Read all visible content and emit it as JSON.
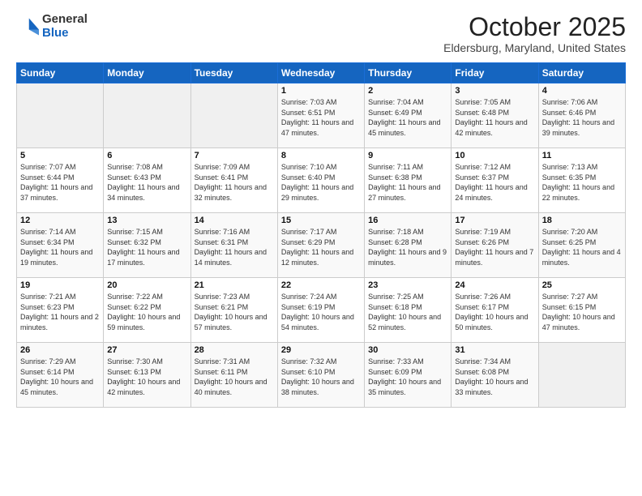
{
  "logo": {
    "general": "General",
    "blue": "Blue"
  },
  "header": {
    "month": "October 2025",
    "location": "Eldersburg, Maryland, United States"
  },
  "weekdays": [
    "Sunday",
    "Monday",
    "Tuesday",
    "Wednesday",
    "Thursday",
    "Friday",
    "Saturday"
  ],
  "weeks": [
    [
      {
        "day": "",
        "info": ""
      },
      {
        "day": "",
        "info": ""
      },
      {
        "day": "",
        "info": ""
      },
      {
        "day": "1",
        "info": "Sunrise: 7:03 AM\nSunset: 6:51 PM\nDaylight: 11 hours and 47 minutes."
      },
      {
        "day": "2",
        "info": "Sunrise: 7:04 AM\nSunset: 6:49 PM\nDaylight: 11 hours and 45 minutes."
      },
      {
        "day": "3",
        "info": "Sunrise: 7:05 AM\nSunset: 6:48 PM\nDaylight: 11 hours and 42 minutes."
      },
      {
        "day": "4",
        "info": "Sunrise: 7:06 AM\nSunset: 6:46 PM\nDaylight: 11 hours and 39 minutes."
      }
    ],
    [
      {
        "day": "5",
        "info": "Sunrise: 7:07 AM\nSunset: 6:44 PM\nDaylight: 11 hours and 37 minutes."
      },
      {
        "day": "6",
        "info": "Sunrise: 7:08 AM\nSunset: 6:43 PM\nDaylight: 11 hours and 34 minutes."
      },
      {
        "day": "7",
        "info": "Sunrise: 7:09 AM\nSunset: 6:41 PM\nDaylight: 11 hours and 32 minutes."
      },
      {
        "day": "8",
        "info": "Sunrise: 7:10 AM\nSunset: 6:40 PM\nDaylight: 11 hours and 29 minutes."
      },
      {
        "day": "9",
        "info": "Sunrise: 7:11 AM\nSunset: 6:38 PM\nDaylight: 11 hours and 27 minutes."
      },
      {
        "day": "10",
        "info": "Sunrise: 7:12 AM\nSunset: 6:37 PM\nDaylight: 11 hours and 24 minutes."
      },
      {
        "day": "11",
        "info": "Sunrise: 7:13 AM\nSunset: 6:35 PM\nDaylight: 11 hours and 22 minutes."
      }
    ],
    [
      {
        "day": "12",
        "info": "Sunrise: 7:14 AM\nSunset: 6:34 PM\nDaylight: 11 hours and 19 minutes."
      },
      {
        "day": "13",
        "info": "Sunrise: 7:15 AM\nSunset: 6:32 PM\nDaylight: 11 hours and 17 minutes."
      },
      {
        "day": "14",
        "info": "Sunrise: 7:16 AM\nSunset: 6:31 PM\nDaylight: 11 hours and 14 minutes."
      },
      {
        "day": "15",
        "info": "Sunrise: 7:17 AM\nSunset: 6:29 PM\nDaylight: 11 hours and 12 minutes."
      },
      {
        "day": "16",
        "info": "Sunrise: 7:18 AM\nSunset: 6:28 PM\nDaylight: 11 hours and 9 minutes."
      },
      {
        "day": "17",
        "info": "Sunrise: 7:19 AM\nSunset: 6:26 PM\nDaylight: 11 hours and 7 minutes."
      },
      {
        "day": "18",
        "info": "Sunrise: 7:20 AM\nSunset: 6:25 PM\nDaylight: 11 hours and 4 minutes."
      }
    ],
    [
      {
        "day": "19",
        "info": "Sunrise: 7:21 AM\nSunset: 6:23 PM\nDaylight: 11 hours and 2 minutes."
      },
      {
        "day": "20",
        "info": "Sunrise: 7:22 AM\nSunset: 6:22 PM\nDaylight: 10 hours and 59 minutes."
      },
      {
        "day": "21",
        "info": "Sunrise: 7:23 AM\nSunset: 6:21 PM\nDaylight: 10 hours and 57 minutes."
      },
      {
        "day": "22",
        "info": "Sunrise: 7:24 AM\nSunset: 6:19 PM\nDaylight: 10 hours and 54 minutes."
      },
      {
        "day": "23",
        "info": "Sunrise: 7:25 AM\nSunset: 6:18 PM\nDaylight: 10 hours and 52 minutes."
      },
      {
        "day": "24",
        "info": "Sunrise: 7:26 AM\nSunset: 6:17 PM\nDaylight: 10 hours and 50 minutes."
      },
      {
        "day": "25",
        "info": "Sunrise: 7:27 AM\nSunset: 6:15 PM\nDaylight: 10 hours and 47 minutes."
      }
    ],
    [
      {
        "day": "26",
        "info": "Sunrise: 7:29 AM\nSunset: 6:14 PM\nDaylight: 10 hours and 45 minutes."
      },
      {
        "day": "27",
        "info": "Sunrise: 7:30 AM\nSunset: 6:13 PM\nDaylight: 10 hours and 42 minutes."
      },
      {
        "day": "28",
        "info": "Sunrise: 7:31 AM\nSunset: 6:11 PM\nDaylight: 10 hours and 40 minutes."
      },
      {
        "day": "29",
        "info": "Sunrise: 7:32 AM\nSunset: 6:10 PM\nDaylight: 10 hours and 38 minutes."
      },
      {
        "day": "30",
        "info": "Sunrise: 7:33 AM\nSunset: 6:09 PM\nDaylight: 10 hours and 35 minutes."
      },
      {
        "day": "31",
        "info": "Sunrise: 7:34 AM\nSunset: 6:08 PM\nDaylight: 10 hours and 33 minutes."
      },
      {
        "day": "",
        "info": ""
      }
    ]
  ]
}
